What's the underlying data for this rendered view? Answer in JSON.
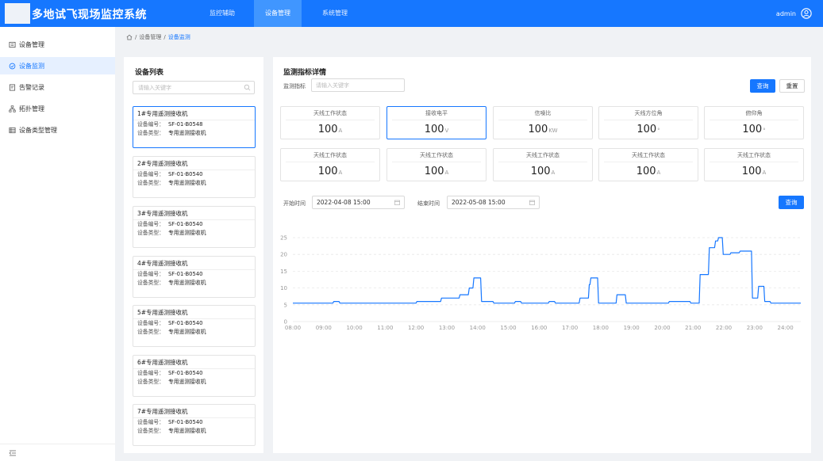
{
  "header": {
    "title": "多地试飞现场监控系统",
    "nav": [
      {
        "label": "监控辅助",
        "active": false
      },
      {
        "label": "设备管理",
        "active": true
      },
      {
        "label": "系统管理",
        "active": false
      }
    ],
    "user": "admin",
    "accent_color": "#1677ff"
  },
  "sidebar": {
    "items": [
      {
        "label": "设备管理",
        "icon": "device-icon",
        "active": false
      },
      {
        "label": "设备监测",
        "icon": "monitor-icon",
        "active": true
      },
      {
        "label": "告警记录",
        "icon": "alarm-record-icon",
        "active": false
      },
      {
        "label": "拓扑管理",
        "icon": "topology-icon",
        "active": false
      },
      {
        "label": "设备类型管理",
        "icon": "list-icon",
        "active": false
      }
    ],
    "collapse_icon": "collapse-icon"
  },
  "breadcrumb": {
    "items": [
      "设备管理",
      "设备监测"
    ],
    "separator": "/",
    "home_icon": "home-icon"
  },
  "device_list": {
    "title": "设备列表",
    "search_placeholder": "请输入关键字",
    "code_label": "设备编号：",
    "type_label": "设备类型：",
    "devices": [
      {
        "name": "1#专用遥测接收机",
        "code": "SF-01-B0548",
        "type": "专用遥测接收机",
        "selected": true
      },
      {
        "name": "2#专用遥测接收机",
        "code": "SF-01-B0540",
        "type": "专用遥测接收机",
        "selected": false
      },
      {
        "name": "3#专用遥测接收机",
        "code": "SF-01-B0540",
        "type": "专用遥测接收机",
        "selected": false
      },
      {
        "name": "4#专用遥测接收机",
        "code": "SF-01-B0540",
        "type": "专用遥测接收机",
        "selected": false
      },
      {
        "name": "5#专用遥测接收机",
        "code": "SF-01-B0540",
        "type": "专用遥测接收机",
        "selected": false
      },
      {
        "name": "6#专用遥测接收机",
        "code": "SF-01-B0540",
        "type": "专用遥测接收机",
        "selected": false
      },
      {
        "name": "7#专用遥测接收机",
        "code": "SF-01-B0540",
        "type": "专用遥测接收机",
        "selected": false
      }
    ]
  },
  "detail": {
    "title": "监测指标详情",
    "filter_label": "监测指标",
    "filter_placeholder": "请输入关键字",
    "query_label": "查询",
    "reset_label": "重置",
    "metrics": [
      {
        "label": "天线工作状态",
        "value": "100",
        "unit": "A",
        "selected": false
      },
      {
        "label": "接收电平",
        "value": "100",
        "unit": "V",
        "selected": true
      },
      {
        "label": "信噪比",
        "value": "100",
        "unit": "KW",
        "selected": false
      },
      {
        "label": "天线方位角",
        "value": "100",
        "unit": "°",
        "selected": false
      },
      {
        "label": "俯仰角",
        "value": "100",
        "unit": "°",
        "selected": false
      },
      {
        "label": "天线工作状态",
        "value": "100",
        "unit": "A",
        "selected": false
      },
      {
        "label": "天线工作状态",
        "value": "100",
        "unit": "A",
        "selected": false
      },
      {
        "label": "天线工作状态",
        "value": "100",
        "unit": "A",
        "selected": false
      },
      {
        "label": "天线工作状态",
        "value": "100",
        "unit": "A",
        "selected": false
      },
      {
        "label": "天线工作状态",
        "value": "100",
        "unit": "A",
        "selected": false
      }
    ],
    "start_label": "开始时间",
    "start_value": "2022-04-08 15:00",
    "end_label": "结束时间",
    "end_value": "2022-05-08 15:00",
    "time_query_label": "查询",
    "calendar_icon": "calendar-icon"
  },
  "chart_data": {
    "type": "line",
    "xlabel": "",
    "ylabel": "",
    "x_ticks": [
      "08:00",
      "09:00",
      "10:00",
      "11:00",
      "12:00",
      "13:00",
      "14:00",
      "15:00",
      "16:00",
      "17:00",
      "18:00",
      "19:00",
      "20:00",
      "21:00",
      "22:00",
      "23:00",
      "24:00"
    ],
    "y_ticks": [
      0,
      5,
      10,
      15,
      20,
      25
    ],
    "ylim": [
      0,
      25
    ],
    "xlim": [
      8,
      24.5
    ],
    "grid": "horizontal-dashed",
    "line_color": "#1677ff",
    "series": [
      {
        "x": [
          8.0,
          9.3,
          9.33,
          9.5,
          9.53,
          10.0,
          10.03,
          11.0,
          11.03,
          12.0,
          12.03,
          12.8,
          12.83,
          13.4,
          13.43,
          13.7,
          13.73,
          13.85,
          13.88,
          14.1,
          14.13,
          14.5,
          14.53,
          15.2,
          15.23,
          15.4,
          15.43,
          15.6,
          15.63,
          16.3,
          16.33,
          16.5,
          16.53,
          17.3,
          17.33,
          17.6,
          17.63,
          17.65,
          17.68,
          17.9,
          17.93,
          18.5,
          18.53,
          18.8,
          18.83,
          19.7,
          19.73,
          20.2,
          20.23,
          20.9,
          20.93,
          21.2,
          21.23,
          21.5,
          21.53,
          21.7,
          21.73,
          21.8,
          21.83,
          21.95,
          21.98,
          22.2,
          22.23,
          22.5,
          22.53,
          22.9,
          22.93,
          23.1,
          23.13,
          23.3,
          23.33,
          23.5,
          23.53,
          24.5
        ],
        "y": [
          5.5,
          5.5,
          6,
          6,
          5.5,
          5.5,
          5.5,
          5.5,
          5.5,
          5.5,
          6,
          6,
          7,
          7,
          8,
          8,
          10,
          10,
          13,
          13,
          6,
          6,
          5.5,
          5.5,
          6,
          6,
          5.5,
          5.5,
          5.5,
          5.5,
          6,
          6,
          5.5,
          5.5,
          7,
          7,
          11,
          11,
          13,
          13,
          5.5,
          5.5,
          8,
          8,
          5.5,
          5.5,
          5.5,
          5.5,
          6,
          6,
          5.5,
          5.5,
          14,
          14,
          22,
          22,
          24,
          24,
          25,
          25,
          20,
          20,
          20.5,
          20.5,
          21,
          21,
          7,
          7,
          10.5,
          10.5,
          6,
          6,
          5.5,
          5.5
        ]
      }
    ]
  }
}
